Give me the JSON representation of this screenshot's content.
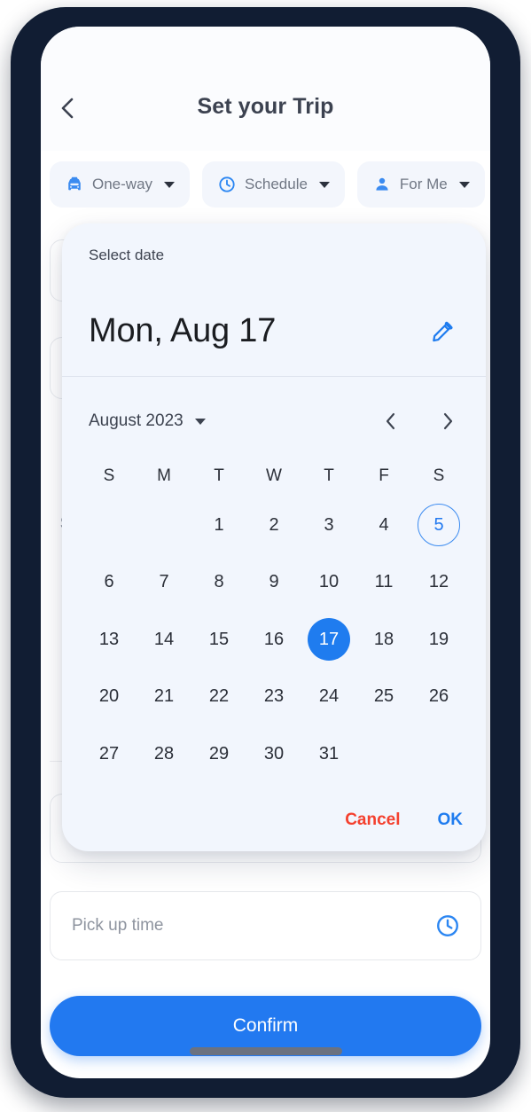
{
  "header": {
    "title": "Set your Trip",
    "back_icon": "chevron-left-icon"
  },
  "chips": [
    {
      "icon": "taxi-icon",
      "label": "One-way",
      "caret": "chevron-down-icon"
    },
    {
      "icon": "clock-icon",
      "label": "Schedule",
      "caret": "chevron-down-icon"
    },
    {
      "icon": "person-icon",
      "label": "For Me",
      "caret": "chevron-down-icon"
    }
  ],
  "background_form": {
    "section_label": "S",
    "pickup_field": {
      "placeholder": "Pick up time",
      "icon": "clock-icon"
    },
    "confirm_label": "Confirm"
  },
  "date_picker": {
    "subtitle": "Select date",
    "selected_date_text": "Mon, Aug 17",
    "edit_icon": "pencil-icon",
    "month_label": "August 2023",
    "month_caret": "chevron-down-icon",
    "prev_icon": "chevron-left-icon",
    "next_icon": "chevron-right-icon",
    "weekday_headers": [
      "S",
      "M",
      "T",
      "W",
      "T",
      "F",
      "S"
    ],
    "weeks": [
      [
        "",
        "",
        "1",
        "2",
        "3",
        "4",
        "5"
      ],
      [
        "6",
        "7",
        "8",
        "9",
        "10",
        "11",
        "12"
      ],
      [
        "13",
        "14",
        "15",
        "16",
        "17",
        "18",
        "19"
      ],
      [
        "20",
        "21",
        "22",
        "23",
        "24",
        "25",
        "26"
      ],
      [
        "27",
        "28",
        "29",
        "30",
        "31",
        "",
        ""
      ]
    ],
    "today": "5",
    "selected": "17",
    "cancel_label": "Cancel",
    "ok_label": "OK"
  },
  "colors": {
    "accent_blue": "#1f7cef",
    "cancel_red": "#f4402e",
    "dialog_surface": "#f2f6fd",
    "frame_navy": "#111d33",
    "chip_surface": "#f3f6fc"
  }
}
